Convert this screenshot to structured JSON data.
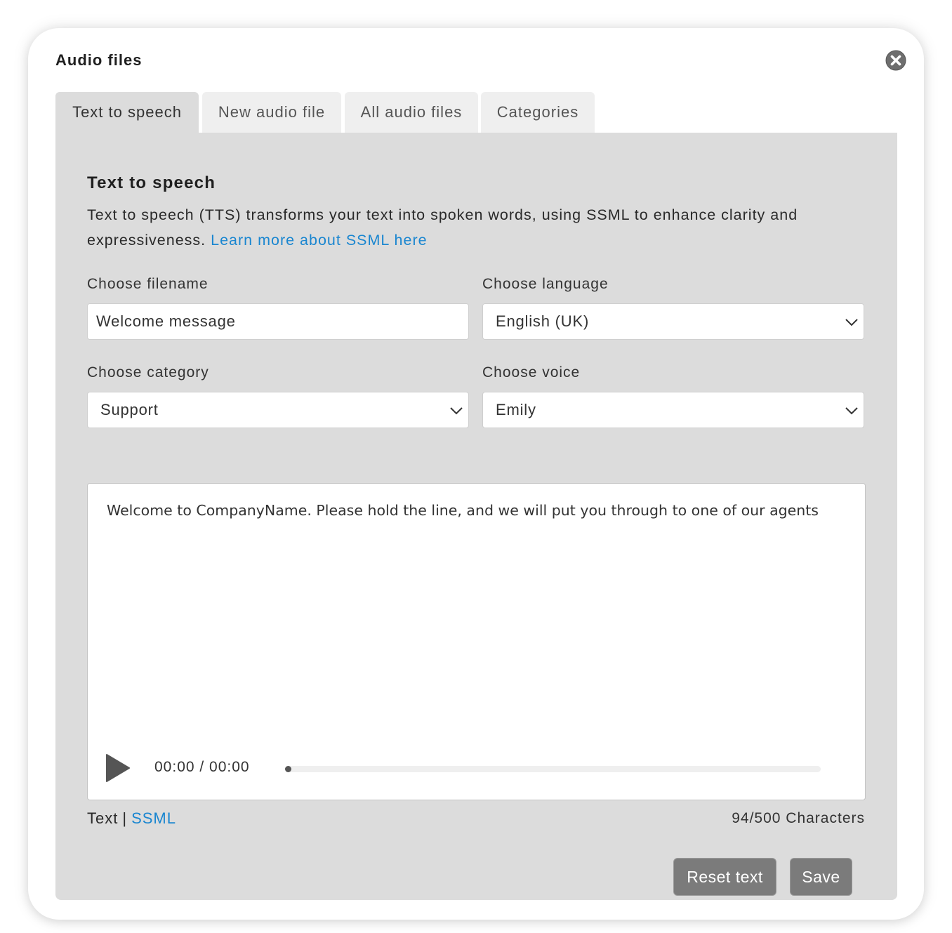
{
  "modal": {
    "title": "Audio files"
  },
  "tabs": [
    {
      "label": "Text to speech",
      "active": true
    },
    {
      "label": "New audio file",
      "active": false
    },
    {
      "label": "All audio files",
      "active": false
    },
    {
      "label": "Categories",
      "active": false
    }
  ],
  "section": {
    "title": "Text to speech",
    "description": "Text to speech (TTS) transforms your text into spoken words, using SSML to enhance clarity and expressiveness.",
    "learn_more_link": "Learn more about SSML here"
  },
  "form": {
    "filename_label": "Choose filename",
    "filename_value": "Welcome message",
    "language_label": "Choose language",
    "language_value": "English (UK)",
    "category_label": "Choose category",
    "category_value": "Support",
    "voice_label": "Choose voice",
    "voice_value": "Emily"
  },
  "editor": {
    "text": "Welcome to CompanyName. Please hold the line, and we will put you through to one of our agents"
  },
  "player": {
    "time": "00:00 / 00:00",
    "progress": 0
  },
  "footer": {
    "mode_text": "Text",
    "mode_separator": "|",
    "mode_ssml": "SSML",
    "char_count": "94/500 Characters"
  },
  "actions": {
    "reset_label": "Reset text",
    "save_label": "Save"
  },
  "colors": {
    "link": "#1a86d0",
    "panel_bg": "#dcdcdc",
    "button_bg": "#7b7b7b"
  },
  "icons": {
    "close": "close-circle-icon",
    "play": "play-icon",
    "dropdown": "chevron-down-icon"
  }
}
